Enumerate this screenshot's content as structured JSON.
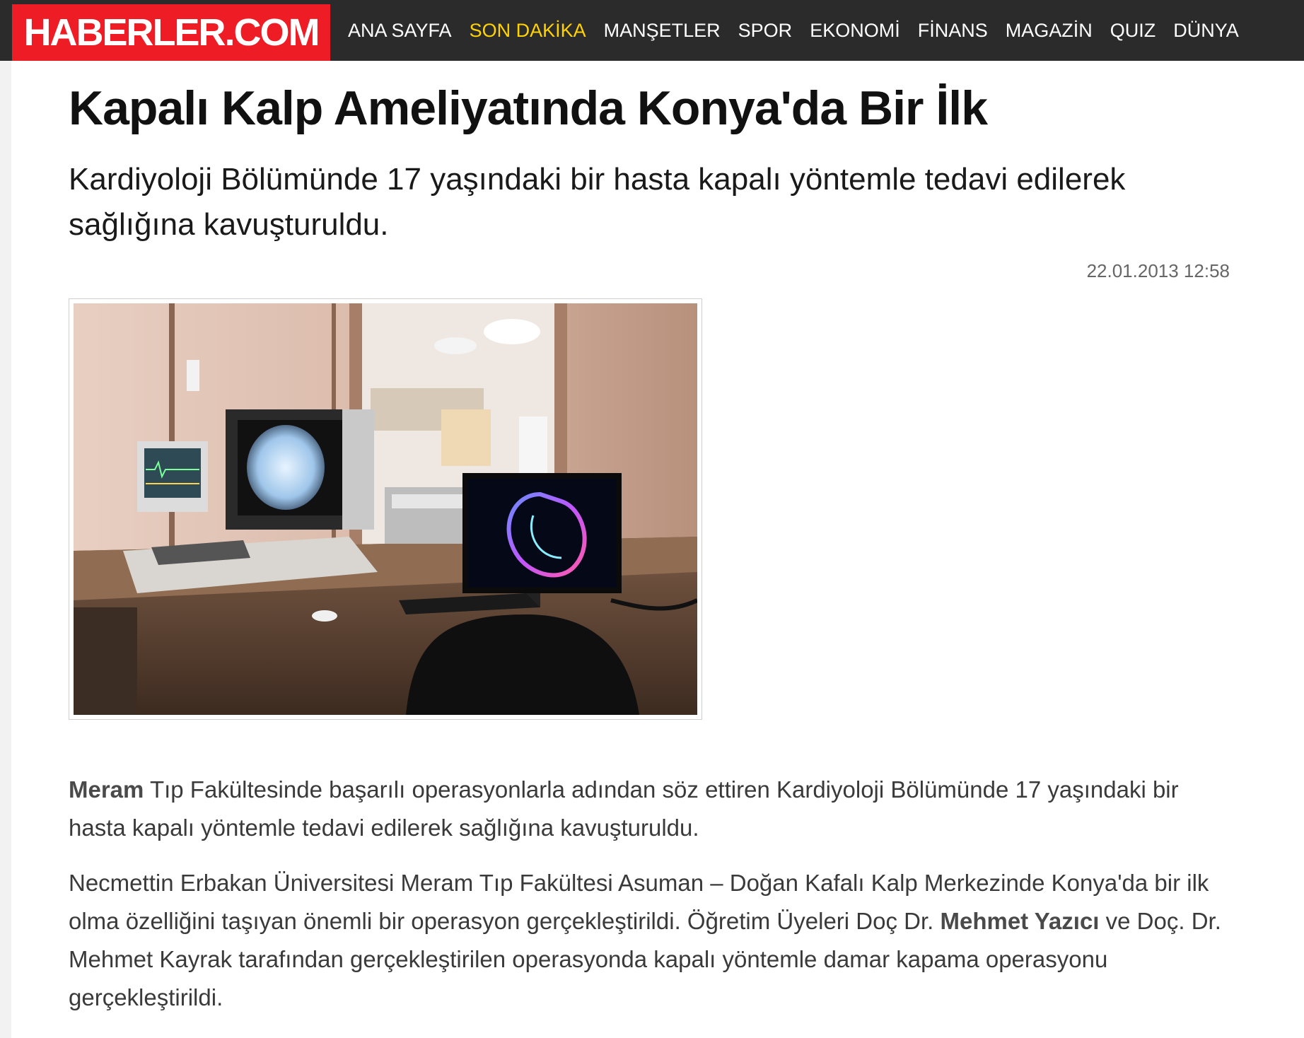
{
  "site": {
    "logo_text": "HABERLER.COM",
    "brand_color": "#ee1c24",
    "nav_active_color": "#ffd200"
  },
  "nav": {
    "items": [
      {
        "label": "ANA SAYFA"
      },
      {
        "label": "SON DAKİKA",
        "active": true
      },
      {
        "label": "MANŞETLER"
      },
      {
        "label": "SPOR"
      },
      {
        "label": "EKONOMİ"
      },
      {
        "label": "FİNANS"
      },
      {
        "label": "MAGAZİN"
      },
      {
        "label": "QUIZ"
      },
      {
        "label": "DÜNYA"
      }
    ]
  },
  "article": {
    "title": "Kapalı Kalp Ameliyatında Konya'da Bir İlk",
    "subtitle": "Kardiyoloji Bölümünde 17 yaşındaki bir hasta kapalı yöntemle tedavi edilerek sağlığına kavuşturuldu.",
    "date": "22.01.2013 12:58",
    "image_icon": "cardiology-room-photo",
    "paragraphs": [
      {
        "lead_bold": "Meram",
        "text": " Tıp Fakültesinde başarılı operasyonlarla adından söz ettiren Kardiyoloji Bölümünde 17 yaşındaki bir hasta kapalı yöntemle tedavi edilerek sağlığına kavuşturuldu."
      },
      {
        "text_before": "Necmettin Erbakan Üniversitesi Meram Tıp Fakültesi Asuman – Doğan Kafalı Kalp Merkezinde Konya'da bir ilk olma özelliğini taşıyan önemli bir operasyon gerçekleştirildi. Öğretim Üyeleri Doç Dr. ",
        "bold": "Mehmet Yazıcı",
        "text_after": " ve Doç. Dr. Mehmet Kayrak tarafından gerçekleştirilen operasyonda kapalı yöntemle damar kapama operasyonu gerçekleştirildi."
      }
    ]
  }
}
